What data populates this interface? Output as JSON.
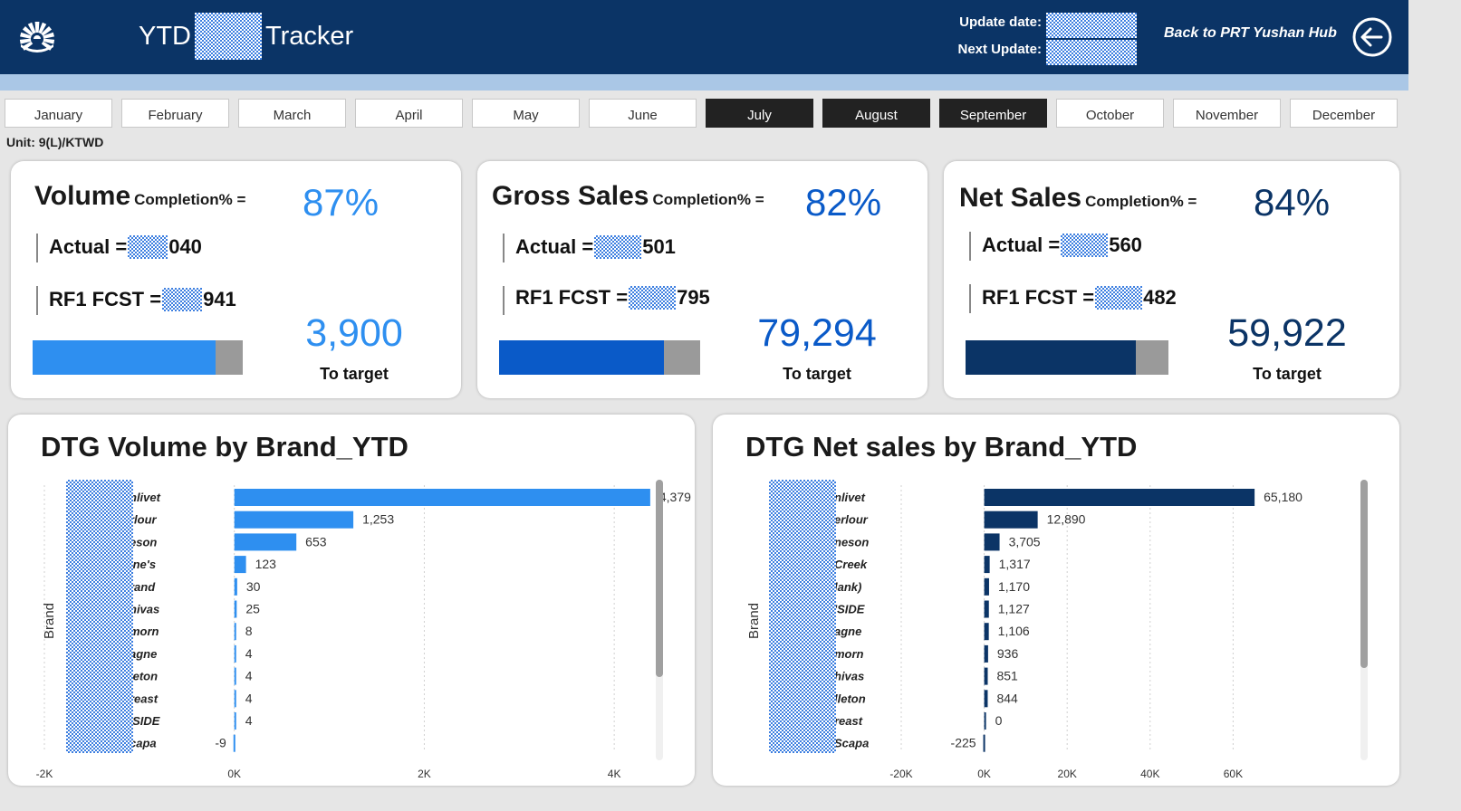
{
  "header": {
    "title_prefix": "YTD",
    "title_suffix": "Tracker",
    "update_date_label": "Update date:",
    "next_update_label": "Next Update:",
    "back_link": "Back to PRT Yushan Hub",
    "colors": {
      "bar": "#0b3466",
      "subbar": "#aac7e6"
    }
  },
  "months": [
    {
      "label": "January",
      "active": false
    },
    {
      "label": "February",
      "active": false
    },
    {
      "label": "March",
      "active": false
    },
    {
      "label": "April",
      "active": false
    },
    {
      "label": "May",
      "active": false
    },
    {
      "label": "June",
      "active": false
    },
    {
      "label": "July",
      "active": true
    },
    {
      "label": "August",
      "active": true
    },
    {
      "label": "September",
      "active": true
    },
    {
      "label": "October",
      "active": false
    },
    {
      "label": "November",
      "active": false
    },
    {
      "label": "December",
      "active": false
    }
  ],
  "unit": "Unit:  9(L)/KTWD",
  "kpis": [
    {
      "name": "Volume",
      "completion_label": "Completion% =",
      "pct": "87%",
      "actual_label": "Actual =",
      "actual_suffix": "040",
      "fcst_label": "RF1 FCST =",
      "fcst_suffix": "941",
      "to_target": "3,900",
      "to_target_label": "To target",
      "fill_fraction": 0.87,
      "color": "#2e8ff0"
    },
    {
      "name": "Gross Sales",
      "completion_label": "Completion% =",
      "pct": "82%",
      "actual_label": "Actual =",
      "actual_suffix": "501",
      "fcst_label": "RF1 FCST =",
      "fcst_suffix": "795",
      "to_target": "79,294",
      "to_target_label": "To target",
      "fill_fraction": 0.82,
      "color": "#0a5ac8"
    },
    {
      "name": "Net Sales",
      "completion_label": "Completion% =",
      "pct": "84%",
      "actual_label": "Actual =",
      "actual_suffix": "560",
      "fcst_label": "RF1 FCST =",
      "fcst_suffix": "482",
      "to_target": "59,922",
      "to_target_label": "To target",
      "fill_fraction": 0.84,
      "color": "#0b3466"
    }
  ],
  "chart_data": [
    {
      "type": "bar",
      "title": "DTG Volume by Brand_YTD",
      "ylabel": "Brand",
      "categories": [
        "nlivet",
        "rlour",
        "eson",
        "ine's",
        "rand",
        "hivas",
        "morn",
        "agne",
        "leton",
        "reast",
        "'SIDE",
        "capa"
      ],
      "values": [
        4379,
        1253,
        653,
        123,
        30,
        25,
        8,
        4,
        4,
        4,
        4,
        -9
      ],
      "value_labels": [
        "4,379",
        "1,253",
        "653",
        "123",
        "30",
        "25",
        "8",
        "4",
        "4",
        "4",
        "4",
        "-9"
      ],
      "xlim": [
        -2000,
        5000
      ],
      "ticks": [
        -2000,
        0,
        2000,
        4000
      ],
      "tick_labels": [
        "-2K",
        "0K",
        "2K",
        "4K"
      ],
      "color": "#2e8ff0"
    },
    {
      "type": "bar",
      "title": "DTG Net sales by Brand_YTD",
      "ylabel": "Brand",
      "categories": [
        "nlivet",
        "erlour",
        "neson",
        "Creek",
        "lank)",
        "'SIDE",
        "agne",
        "morn",
        "hivas",
        "lleton",
        "reast",
        "Scapa"
      ],
      "values": [
        65180,
        12890,
        3705,
        1317,
        1170,
        1127,
        1106,
        936,
        851,
        844,
        0,
        -225
      ],
      "value_labels": [
        "65,180",
        "12,890",
        "3,705",
        "1,317",
        "1,170",
        "1,127",
        "1,106",
        "936",
        "851",
        "844",
        "0",
        "-225"
      ],
      "xlim": [
        -20000,
        80000
      ],
      "ticks": [
        -20000,
        0,
        20000,
        40000,
        60000
      ],
      "tick_labels": [
        "-20K",
        "0K",
        "20K",
        "40K",
        "60K"
      ],
      "color": "#0b3466"
    }
  ]
}
